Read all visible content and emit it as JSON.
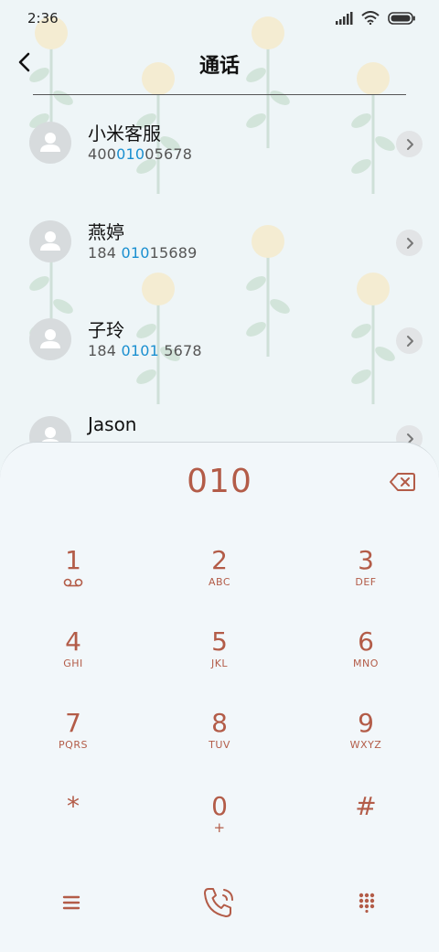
{
  "status_bar": {
    "time": "2:36"
  },
  "header": {
    "title": "通话"
  },
  "contacts": [
    {
      "name": "小米客服",
      "num_pre": "400",
      "num_hl": "010",
      "num_post": "05678"
    },
    {
      "name": "燕婷",
      "num_pre": "184 ",
      "num_hl": "010",
      "num_post": "15689"
    },
    {
      "name": "子玲",
      "num_pre": "184 ",
      "num_hl": "0101",
      "num_post": " 5678"
    },
    {
      "name": "Jason"
    }
  ],
  "dialpad": {
    "entered": "010",
    "keys": [
      {
        "digit": "1",
        "letters": ""
      },
      {
        "digit": "2",
        "letters": "ABC"
      },
      {
        "digit": "3",
        "letters": "DEF"
      },
      {
        "digit": "4",
        "letters": "GHI"
      },
      {
        "digit": "5",
        "letters": "JKL"
      },
      {
        "digit": "6",
        "letters": "MNO"
      },
      {
        "digit": "7",
        "letters": "PQRS"
      },
      {
        "digit": "8",
        "letters": "TUV"
      },
      {
        "digit": "9",
        "letters": "WXYZ"
      },
      {
        "digit": "*",
        "letters": ""
      },
      {
        "digit": "0",
        "letters": "+"
      },
      {
        "digit": "#",
        "letters": ""
      }
    ]
  },
  "colors": {
    "accent": "#b35c48",
    "highlight": "#1a8fd0",
    "background": "#eef5f7"
  },
  "icons": [
    "back-icon",
    "signal-icon",
    "wifi-icon",
    "battery-icon",
    "chevron-right-icon",
    "backspace-icon",
    "voicemail-icon",
    "menu-icon",
    "call-icon",
    "dialpad-icon"
  ]
}
